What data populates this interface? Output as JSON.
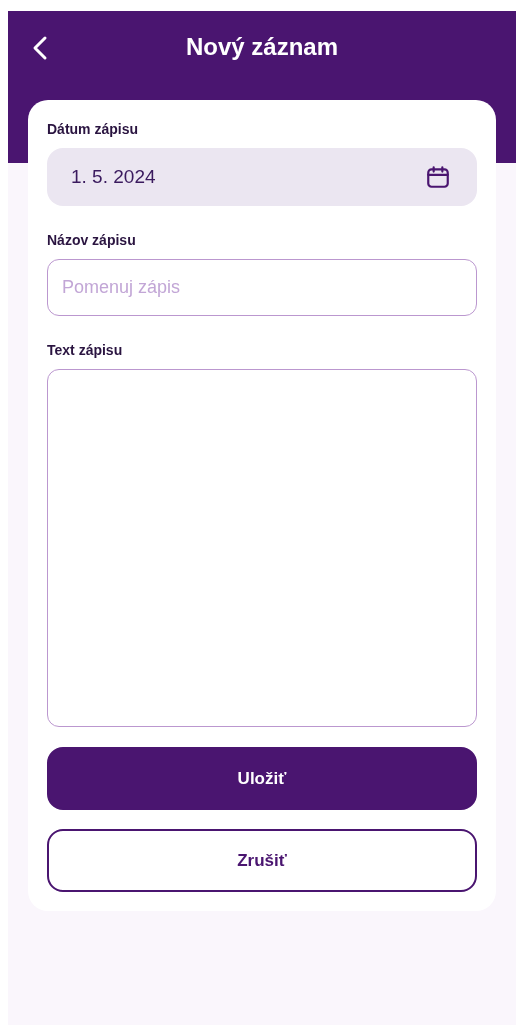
{
  "header": {
    "title": "Nový záznam"
  },
  "fields": [
    {
      "kind": "date",
      "label": "Dátum zápisu",
      "value": "1. 5. 2024"
    },
    {
      "kind": "text",
      "label": "Názov zápisu",
      "placeholder": "Pomenuj zápis"
    },
    {
      "kind": "textarea",
      "label": "Text zápisu"
    }
  ],
  "buttons": [
    {
      "kind": "primary",
      "label": "Uložiť"
    },
    {
      "kind": "secondary",
      "label": "Zrušiť"
    }
  ]
}
